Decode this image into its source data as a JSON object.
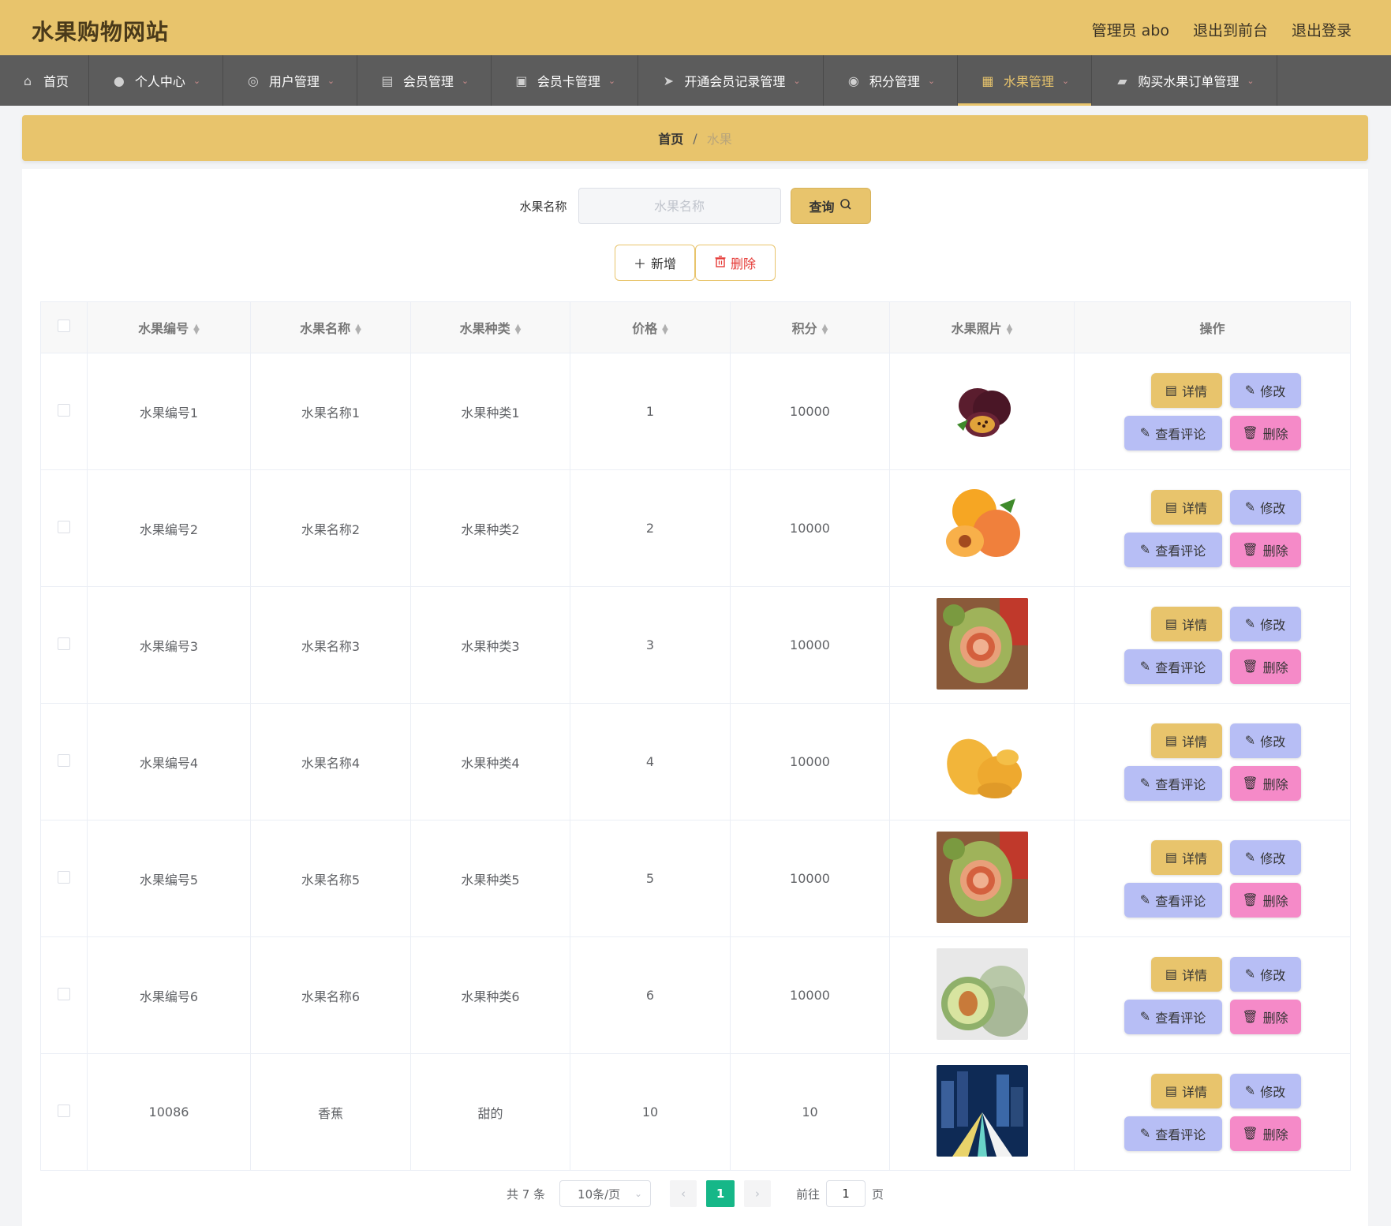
{
  "header": {
    "site_title": "水果购物网站",
    "admin_label": "管理员 abo",
    "to_front_label": "退出到前台",
    "logout_label": "退出登录"
  },
  "nav": {
    "items": [
      {
        "label": "首页",
        "icon": "home-icon",
        "chev": false,
        "active": false
      },
      {
        "label": "个人中心",
        "icon": "user-icon",
        "chev": true,
        "active": false
      },
      {
        "label": "用户管理",
        "icon": "dashboard-icon",
        "chev": true,
        "active": false
      },
      {
        "label": "会员管理",
        "icon": "clipboard-icon",
        "chev": true,
        "active": false
      },
      {
        "label": "会员卡管理",
        "icon": "chat-icon",
        "chev": true,
        "active": false
      },
      {
        "label": "开通会员记录管理",
        "icon": "send-icon",
        "chev": true,
        "active": false
      },
      {
        "label": "积分管理",
        "icon": "ring-icon",
        "chev": true,
        "active": false
      },
      {
        "label": "水果管理",
        "icon": "grid-icon",
        "chev": true,
        "active": true
      },
      {
        "label": "购买水果订单管理",
        "icon": "cart-icon",
        "chev": true,
        "active": false
      }
    ]
  },
  "breadcrumb": {
    "home": "首页",
    "separator": "/",
    "current": "水果"
  },
  "search": {
    "label": "水果名称",
    "placeholder": "水果名称",
    "query_label": "查询"
  },
  "actions": {
    "add_label": "新增",
    "delete_label": "删除"
  },
  "table": {
    "columns": [
      "水果编号",
      "水果名称",
      "水果种类",
      "价格",
      "积分",
      "水果照片",
      "操作"
    ],
    "rows": [
      {
        "id": "水果编号1",
        "name": "水果名称1",
        "type": "水果种类1",
        "price": "1",
        "points": "10000",
        "photo": "passion-fruit"
      },
      {
        "id": "水果编号2",
        "name": "水果名称2",
        "type": "水果种类2",
        "price": "2",
        "points": "10000",
        "photo": "apricot"
      },
      {
        "id": "水果编号3",
        "name": "水果名称3",
        "type": "水果种类3",
        "price": "3",
        "points": "10000",
        "photo": "carved-melon"
      },
      {
        "id": "水果编号4",
        "name": "水果名称4",
        "type": "水果种类4",
        "price": "4",
        "points": "10000",
        "photo": "mango"
      },
      {
        "id": "水果编号5",
        "name": "水果名称5",
        "type": "水果种类5",
        "price": "5",
        "points": "10000",
        "photo": "carved-melon"
      },
      {
        "id": "水果编号6",
        "name": "水果名称6",
        "type": "水果种类6",
        "price": "6",
        "points": "10000",
        "photo": "cantaloupe"
      },
      {
        "id": "10086",
        "name": "香蕉",
        "type": "甜的",
        "price": "10",
        "points": "10",
        "photo": "city-night"
      }
    ],
    "op_labels": {
      "detail": "详情",
      "edit": "修改",
      "comment": "查看评论",
      "delete": "删除"
    }
  },
  "pagination": {
    "total_label": "共 7 条",
    "page_size": "10条/页",
    "current_page": "1",
    "goto_label": "前往",
    "goto_value": "1",
    "page_suffix": "页"
  },
  "colors": {
    "accent": "#e8c46c",
    "nav_bg": "#5c5c5c",
    "edit_btn": "#b7bef5",
    "delete_btn": "#f58ac8",
    "page_active": "#16b788"
  }
}
